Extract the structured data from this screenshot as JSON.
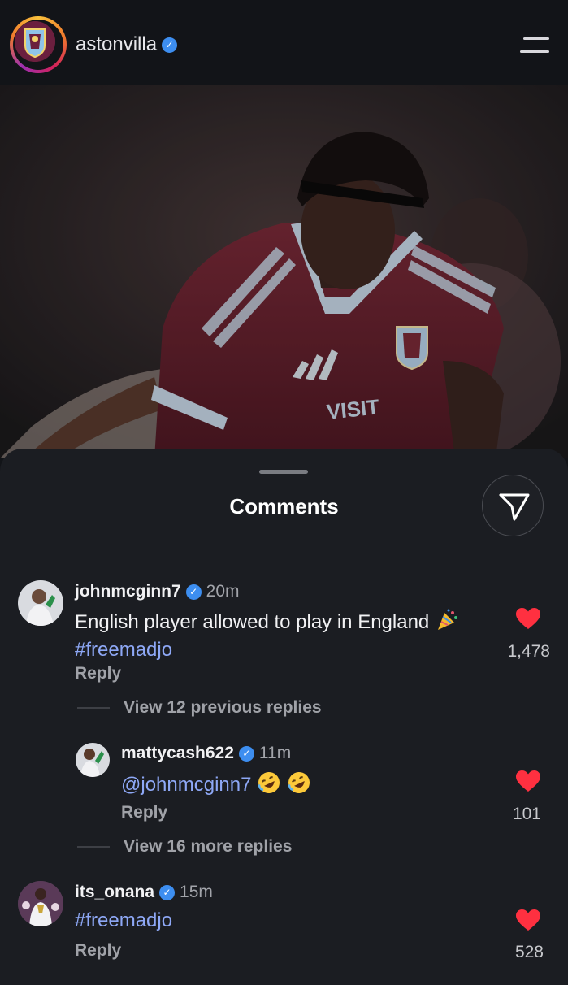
{
  "header": {
    "username": "astonvilla",
    "verified_icon": "verified-badge-icon",
    "menu_icon": "hamburger-menu-icon"
  },
  "sheet": {
    "title": "Comments",
    "send_icon": "send-icon"
  },
  "comments": [
    {
      "username": "johnmcginn7",
      "time": "20m",
      "text": "English player allowed to play in England",
      "emoji": "party-popper",
      "hashtag": "#freemadjo",
      "reply_label": "Reply",
      "likes": "1,478",
      "view_replies": "View 12 previous replies"
    },
    {
      "username": "mattycash622",
      "time": "11m",
      "mention": "@johnmcginn7",
      "emoji": "rolling-on-floor-laughing x2",
      "reply_label": "Reply",
      "likes": "101",
      "view_replies": "View 16 more replies"
    },
    {
      "username": "its_onana",
      "time": "15m",
      "hashtag": "#freemadjo",
      "reply_label": "Reply",
      "likes": "528"
    }
  ],
  "colors": {
    "background": "#121418",
    "sheet": "#1b1d22",
    "verified": "#3d8ef0",
    "hashtag": "#8ea8f6",
    "heart": "#ff3040",
    "shirt": "#6e2230"
  }
}
